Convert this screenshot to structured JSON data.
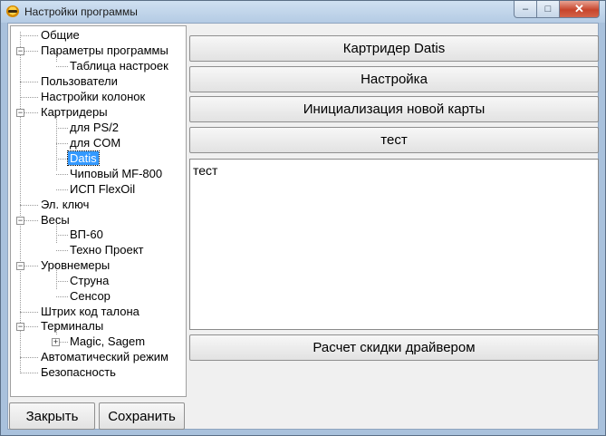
{
  "window": {
    "title": "Настройки программы"
  },
  "tree": {
    "items": [
      {
        "label": "Общие"
      },
      {
        "label": "Параметры программы"
      },
      {
        "label": "Таблица настроек"
      },
      {
        "label": "Пользователи"
      },
      {
        "label": "Настройки колонок"
      },
      {
        "label": "Картридеры"
      },
      {
        "label": "для PS/2"
      },
      {
        "label": "для COM"
      },
      {
        "label": "Datis"
      },
      {
        "label": "Чиповый MF-800"
      },
      {
        "label": "ИСП FlexOil"
      },
      {
        "label": "Эл. ключ"
      },
      {
        "label": "Весы"
      },
      {
        "label": "ВП-60"
      },
      {
        "label": "Техно Проект"
      },
      {
        "label": "Уровнемеры"
      },
      {
        "label": "Струна"
      },
      {
        "label": "Сенсор"
      },
      {
        "label": "Штрих код талона"
      },
      {
        "label": "Терминалы"
      },
      {
        "label": "Magic, Sagem"
      },
      {
        "label": "Автоматический режим"
      },
      {
        "label": "Безопасность"
      }
    ],
    "selected_label": "Datis"
  },
  "main": {
    "buttons": [
      {
        "label": "Картридер Datis"
      },
      {
        "label": "Настройка"
      },
      {
        "label": "Инициализация новой карты"
      },
      {
        "label": "тест"
      }
    ],
    "memo_text": "тест",
    "discount_button": "Расчет скидки драйвером"
  },
  "footer": {
    "close_label": "Закрыть",
    "save_label": "Сохранить"
  },
  "colors": {
    "selection": "#3399ff",
    "close_button": "#c7452c"
  }
}
